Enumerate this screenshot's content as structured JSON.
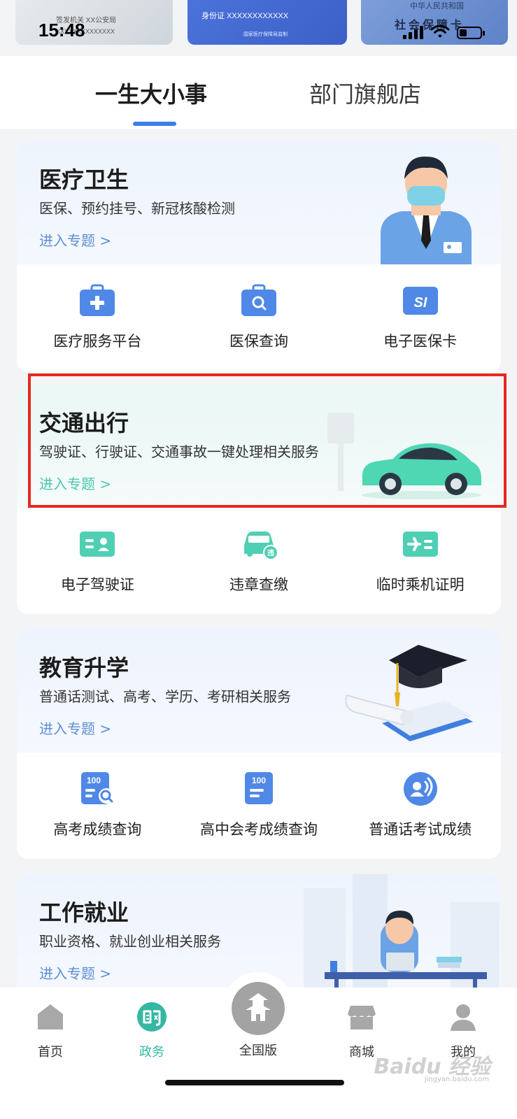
{
  "status_bar": {
    "time": "15:48"
  },
  "top_cards": {
    "card1": {
      "line1": "签发机关 XX公安局",
      "line2": "XXXXXXXXXXXXXX"
    },
    "card2": {
      "line1": "身份证 XXXXXXXXXXXX",
      "line2": "国家医疗保障局监制"
    },
    "card3": {
      "line1": "中华人民共和国",
      "line2": "社会保障卡"
    }
  },
  "tabs": {
    "active": "一生大小事",
    "inactive": "部门旗舰店"
  },
  "sections": {
    "medical": {
      "title": "医疗卫生",
      "subtitle": "医保、预约挂号、新冠核酸检测",
      "link": "进入专题 >",
      "items": [
        {
          "label": "医疗服务平台",
          "icon": "medical-kit-icon"
        },
        {
          "label": "医保查询",
          "icon": "search-bag-icon"
        },
        {
          "label": "电子医保卡",
          "icon": "si-card-icon"
        }
      ]
    },
    "traffic": {
      "title": "交通出行",
      "subtitle": "驾驶证、行驶证、交通事故一键处理相关服务",
      "link": "进入专题 >",
      "items": [
        {
          "label": "电子驾驶证",
          "icon": "license-card-icon"
        },
        {
          "label": "违章查缴",
          "icon": "violation-car-icon",
          "badge": "违"
        },
        {
          "label": "临时乘机证明",
          "icon": "flight-certificate-icon"
        }
      ]
    },
    "education": {
      "title": "教育升学",
      "subtitle": "普通话测试、高考、学历、考研相关服务",
      "link": "进入专题 >",
      "items": [
        {
          "label": "高考成绩查询",
          "icon": "score-search-icon",
          "badge": "100"
        },
        {
          "label": "高中会考成绩查询",
          "icon": "score-doc-icon",
          "badge": "100"
        },
        {
          "label": "普通话考试成绩",
          "icon": "speech-icon"
        }
      ]
    },
    "work": {
      "title": "工作就业",
      "subtitle": "职业资格、就业创业相关服务",
      "link": "进入专题 >"
    }
  },
  "bottom_nav": {
    "items": [
      {
        "label": "首页",
        "icon": "home-icon"
      },
      {
        "label": "政务",
        "icon": "gov-icon",
        "active": true
      },
      {
        "label": "全国版",
        "icon": "pagoda-icon"
      },
      {
        "label": "商城",
        "icon": "store-icon"
      },
      {
        "label": "我的",
        "icon": "user-icon"
      }
    ]
  },
  "watermark": {
    "text": "Baidu 经验",
    "sub": "jingyan.baidu.com"
  },
  "colors": {
    "accent_blue": "#3d7de9",
    "accent_teal": "#4cc7b3",
    "highlight_red": "#e7281f"
  }
}
